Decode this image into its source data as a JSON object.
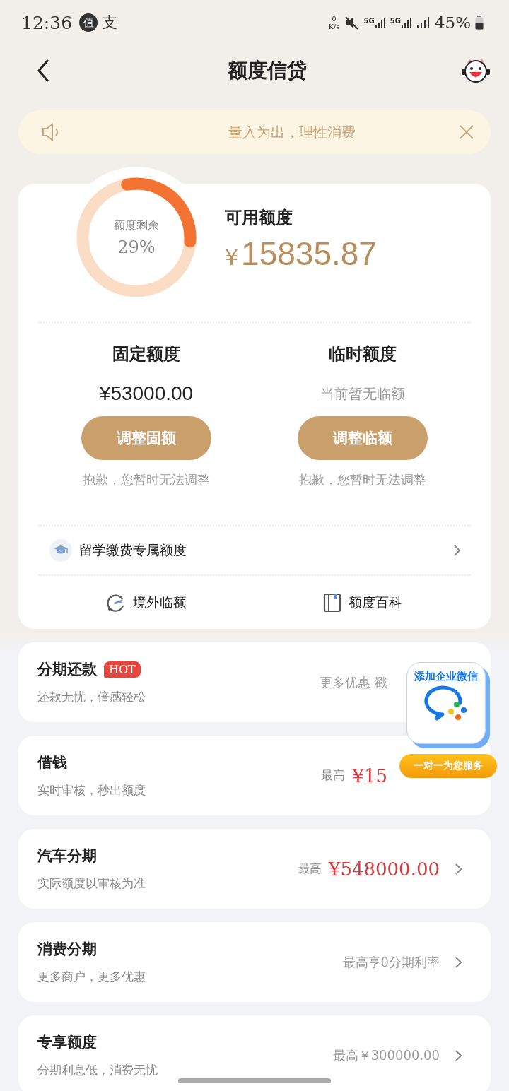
{
  "status_bar": {
    "time": "12:36",
    "app_badges": [
      "值",
      "支"
    ],
    "net_speed": [
      "0",
      "K/s"
    ],
    "networks": [
      "5G",
      "5G"
    ],
    "battery": "45%"
  },
  "nav": {
    "title": "额度信贷"
  },
  "notice": {
    "text": "量入为出，理性消费"
  },
  "quota": {
    "ring_label": "额度剩余",
    "ring_value": "29%",
    "level": 0.29,
    "available_label": "可用额度",
    "currency": "¥",
    "available_amount": "15835.87",
    "columns": [
      {
        "title": "固定额度",
        "value": "¥53000.00",
        "kind": "amount",
        "button": "调整固额",
        "note": "抱歉，您暂时无法调整"
      },
      {
        "title": "临时额度",
        "value": "当前暂无临额",
        "kind": "hint",
        "button": "调整临额",
        "note": "抱歉，您暂时无法调整"
      }
    ],
    "study": {
      "label": "留学缴费专属额度"
    },
    "links": [
      {
        "label": "境外临额",
        "kind": "plane"
      },
      {
        "label": "额度百科",
        "kind": "book"
      }
    ]
  },
  "products": [
    {
      "title": "分期还款",
      "badge": "HOT",
      "subtitle": "还款无忧，倍感轻松",
      "kind": "note",
      "right": "更多优惠 戳",
      "chevron": false
    },
    {
      "title": "借钱",
      "subtitle": "实时审核，秒出额度",
      "kind": "amount",
      "prefix": "最高",
      "right": "¥15",
      "chevron": false
    },
    {
      "title": "汽车分期",
      "subtitle": "实际额度以审核为准",
      "kind": "amount",
      "prefix": "最高",
      "right": "¥548000.00",
      "chevron": true
    },
    {
      "title": "消费分期",
      "subtitle": "更多商户，更多优惠",
      "kind": "note",
      "right": "最高享0分期利率",
      "chevron": true
    },
    {
      "title": "专享额度",
      "subtitle": "分期利息低，消费无忧",
      "kind": "note",
      "right": "最高￥300000.00",
      "chevron": true
    }
  ],
  "float_widget": {
    "title": "添加企业微信",
    "pill": "一对一为您服务"
  }
}
